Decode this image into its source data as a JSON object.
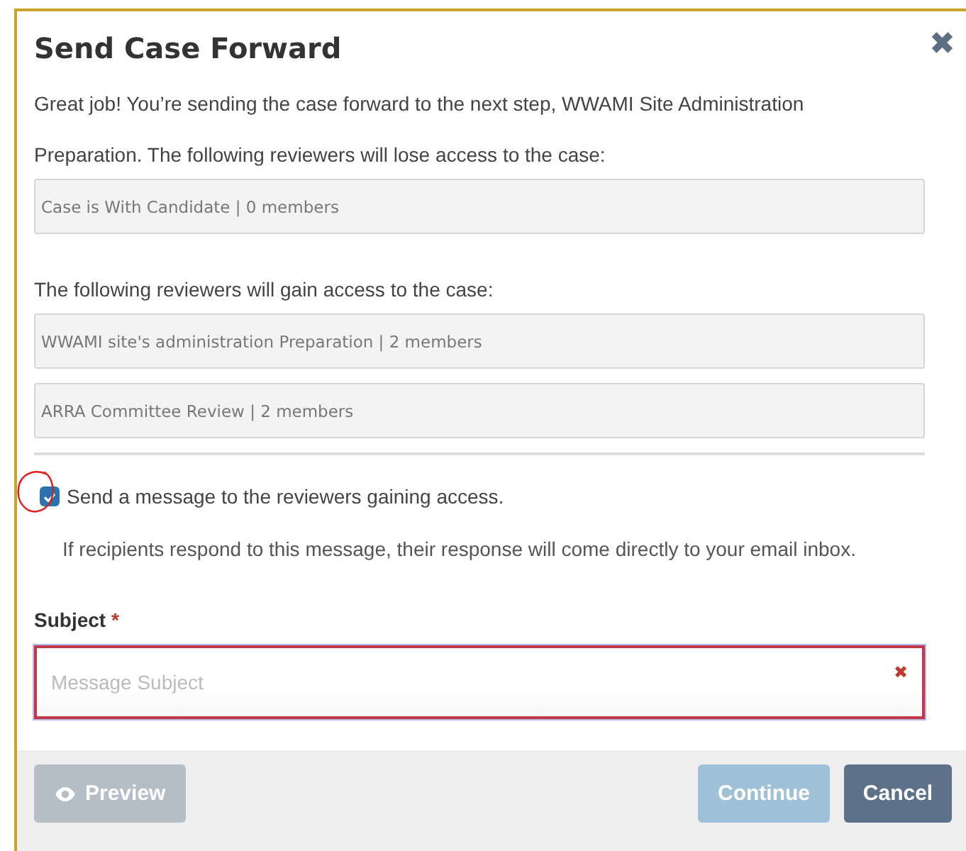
{
  "dialog": {
    "title": "Send Case Forward",
    "close": "✖"
  },
  "intro": [
    "Great job! You’re sending the case forward to the next step, WWAMI Site Administration",
    "Preparation. The following reviewers will lose access to the case:"
  ],
  "losing": [
    "Case is With Candidate | 0 members"
  ],
  "gaining_label": "The following reviewers will gain access to the case:",
  "gaining": [
    "WWAMI site's administration Preparation | 2 members",
    "ARRA Committee Review | 2 members"
  ],
  "send_message": {
    "label": "Send a message to the reviewers gaining access.",
    "checked": true
  },
  "note": "If recipients respond to this message, their response will come directly to your email inbox.",
  "subject": {
    "label": "Subject",
    "required": "*",
    "placeholder": "Message Subject",
    "invalid": true,
    "clear": "✖"
  },
  "buttons": [
    {
      "label": "Preview",
      "kind": "preview",
      "disabled": true
    },
    {
      "label": "Continue",
      "kind": "primary",
      "disabled": true
    },
    {
      "label": "Cancel",
      "kind": "secondary",
      "disabled": false
    }
  ]
}
